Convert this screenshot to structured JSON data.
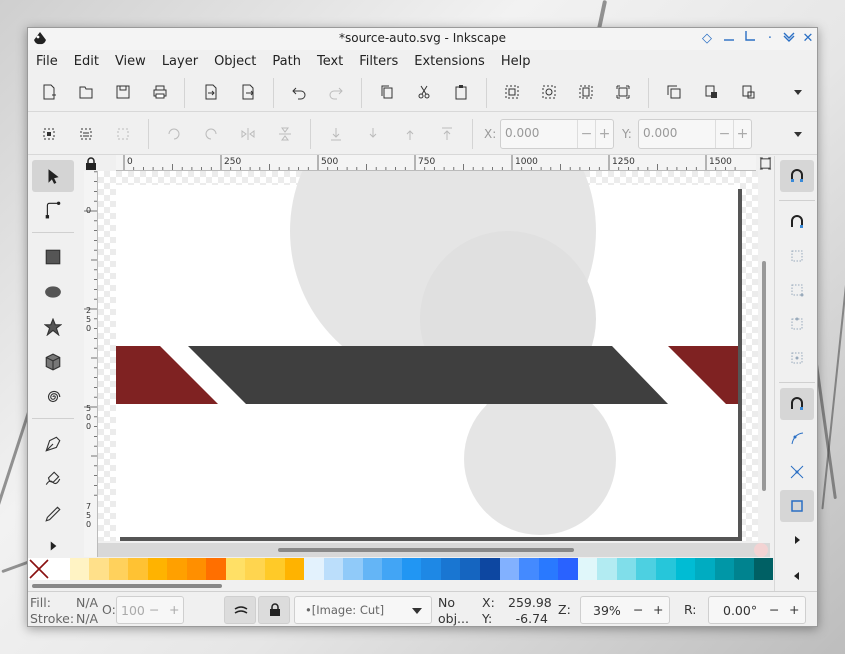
{
  "window": {
    "title": "*source-auto.svg - Inkscape",
    "controls": {
      "shade": "◇",
      "minimize": "—",
      "maximize": "L",
      "restore": "·",
      "close": "✕"
    }
  },
  "menu": [
    "File",
    "Edit",
    "View",
    "Layer",
    "Object",
    "Path",
    "Text",
    "Filters",
    "Extensions",
    "Help"
  ],
  "commands": [
    "new-document-icon",
    "open-icon",
    "save-icon",
    "print-icon",
    "import-icon",
    "export-icon",
    "undo-icon",
    "redo-icon",
    "copy-icon",
    "cut-icon",
    "paste-icon",
    "zoom-selection-icon",
    "zoom-drawing-icon",
    "zoom-page-icon",
    "zoom-page-width-icon",
    "duplicate-icon",
    "clone-icon",
    "unlink-clone-icon",
    "more-icon"
  ],
  "tool_controls": {
    "x_label": "X:",
    "x_value": "0.000",
    "y_label": "Y:",
    "y_value": "0.000",
    "minus": "−",
    "plus": "+"
  },
  "ruler": {
    "top_labels": [
      "0",
      "250",
      "500",
      "750",
      "1000",
      "1250",
      "1500"
    ],
    "left_labels": [
      "0",
      "250",
      "500",
      "750"
    ]
  },
  "tools": [
    "select-tool-icon",
    "node-tool-icon",
    "rect-tool-icon",
    "ellipse-tool-icon",
    "star-tool-icon",
    "3dbox-tool-icon",
    "spiral-tool-icon",
    "pen-tool-icon",
    "calligraphy-tool-icon",
    "pencil-tool-icon",
    "expand-tools-icon"
  ],
  "snap": [
    "snap-enable-icon",
    "snap-bbox-icon",
    "snap-bbox-edge-icon",
    "snap-bbox-corner-icon",
    "snap-bbox-mid-icon",
    "snap-bbox-center-icon",
    "snap-nodes-icon",
    "snap-path-icon",
    "snap-intersection-icon",
    "snap-page-icon",
    "snap-more-icon"
  ],
  "palette": {
    "colors": [
      "#ffffff",
      "#fff3c4",
      "#ffe08a",
      "#ffd15c",
      "#ffc233",
      "#ffb300",
      "#ffa000",
      "#ff8f00",
      "#ff6f00",
      "#ffe066",
      "#ffd54f",
      "#ffca28",
      "#ffb300",
      "#e3f2fd",
      "#bbdefb",
      "#90caf9",
      "#64b5f6",
      "#42a5f5",
      "#2196f3",
      "#1e88e5",
      "#1976d2",
      "#1565c0",
      "#0d47a1",
      "#82b1ff",
      "#448aff",
      "#2979ff",
      "#2962ff",
      "#e0f7fa",
      "#b2ebf2",
      "#80deea",
      "#4dd0e1",
      "#26c6da",
      "#00bcd4",
      "#00acc1",
      "#0097a7",
      "#00838f",
      "#006064"
    ]
  },
  "status": {
    "fill_label": "Fill:",
    "fill_value": "N/A",
    "stroke_label": "Stroke:",
    "stroke_value": "N/A",
    "opacity_label": "O:",
    "opacity_value": "100",
    "layer": "•[Image: Cut]",
    "no_obj_line1": "No",
    "no_obj_line2": "obj...",
    "x_label": "X:",
    "x_value": "259.98",
    "y_label": "Y:",
    "y_value": "-6.74",
    "zoom_label": "Z:",
    "zoom_value": "39%",
    "rotate_label": "R:",
    "rotate_value": "0.00°"
  },
  "canvas_colors": {
    "dark_red": "#7f2222",
    "dark_gray": "#3f3f3f",
    "circle_gray": "#e5e5e5"
  }
}
